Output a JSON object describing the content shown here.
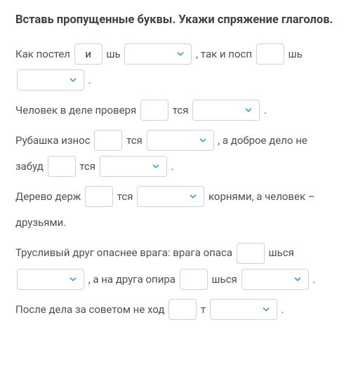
{
  "heading": "Вставь пропущенные буквы. Укажи спряжение глаголов.",
  "rows": [
    {
      "s1": "Как постел",
      "in1": "и",
      "s2": "шь",
      "sel1": "",
      "s3": " , так и посп",
      "in2": "",
      "s4": "шь",
      "sel2": "",
      "s5": " ."
    },
    {
      "s1": "Человек в деле проверя",
      "in1": "",
      "s2": "тся",
      "sel1": "",
      "s3": " ."
    },
    {
      "s1": "Рубашка износ",
      "in1": "",
      "s2": "тся",
      "sel1": "",
      "s3": " , а доброе дело не забуд",
      "in2": "",
      "s4": "тся",
      "sel2": "",
      "s5": " ."
    },
    {
      "s1": "Дерево держ",
      "in1": "",
      "s2": "тся",
      "sel1": "",
      "s3": " корнями, а человек – друзьями."
    },
    {
      "s1": "Трусливый друг опаснее врага: врага опаса",
      "in1": "",
      "s2": "шься",
      "sel1": "",
      "s3": " , а на друга опира",
      "in2": "",
      "s4": "шься",
      "sel2": "",
      "s5": " ."
    },
    {
      "s1": "После дела за советом не ход",
      "in1": "",
      "s2": "т",
      "sel1": "",
      "s3": " ."
    }
  ],
  "icons": {
    "chevron": "chevron-down"
  }
}
